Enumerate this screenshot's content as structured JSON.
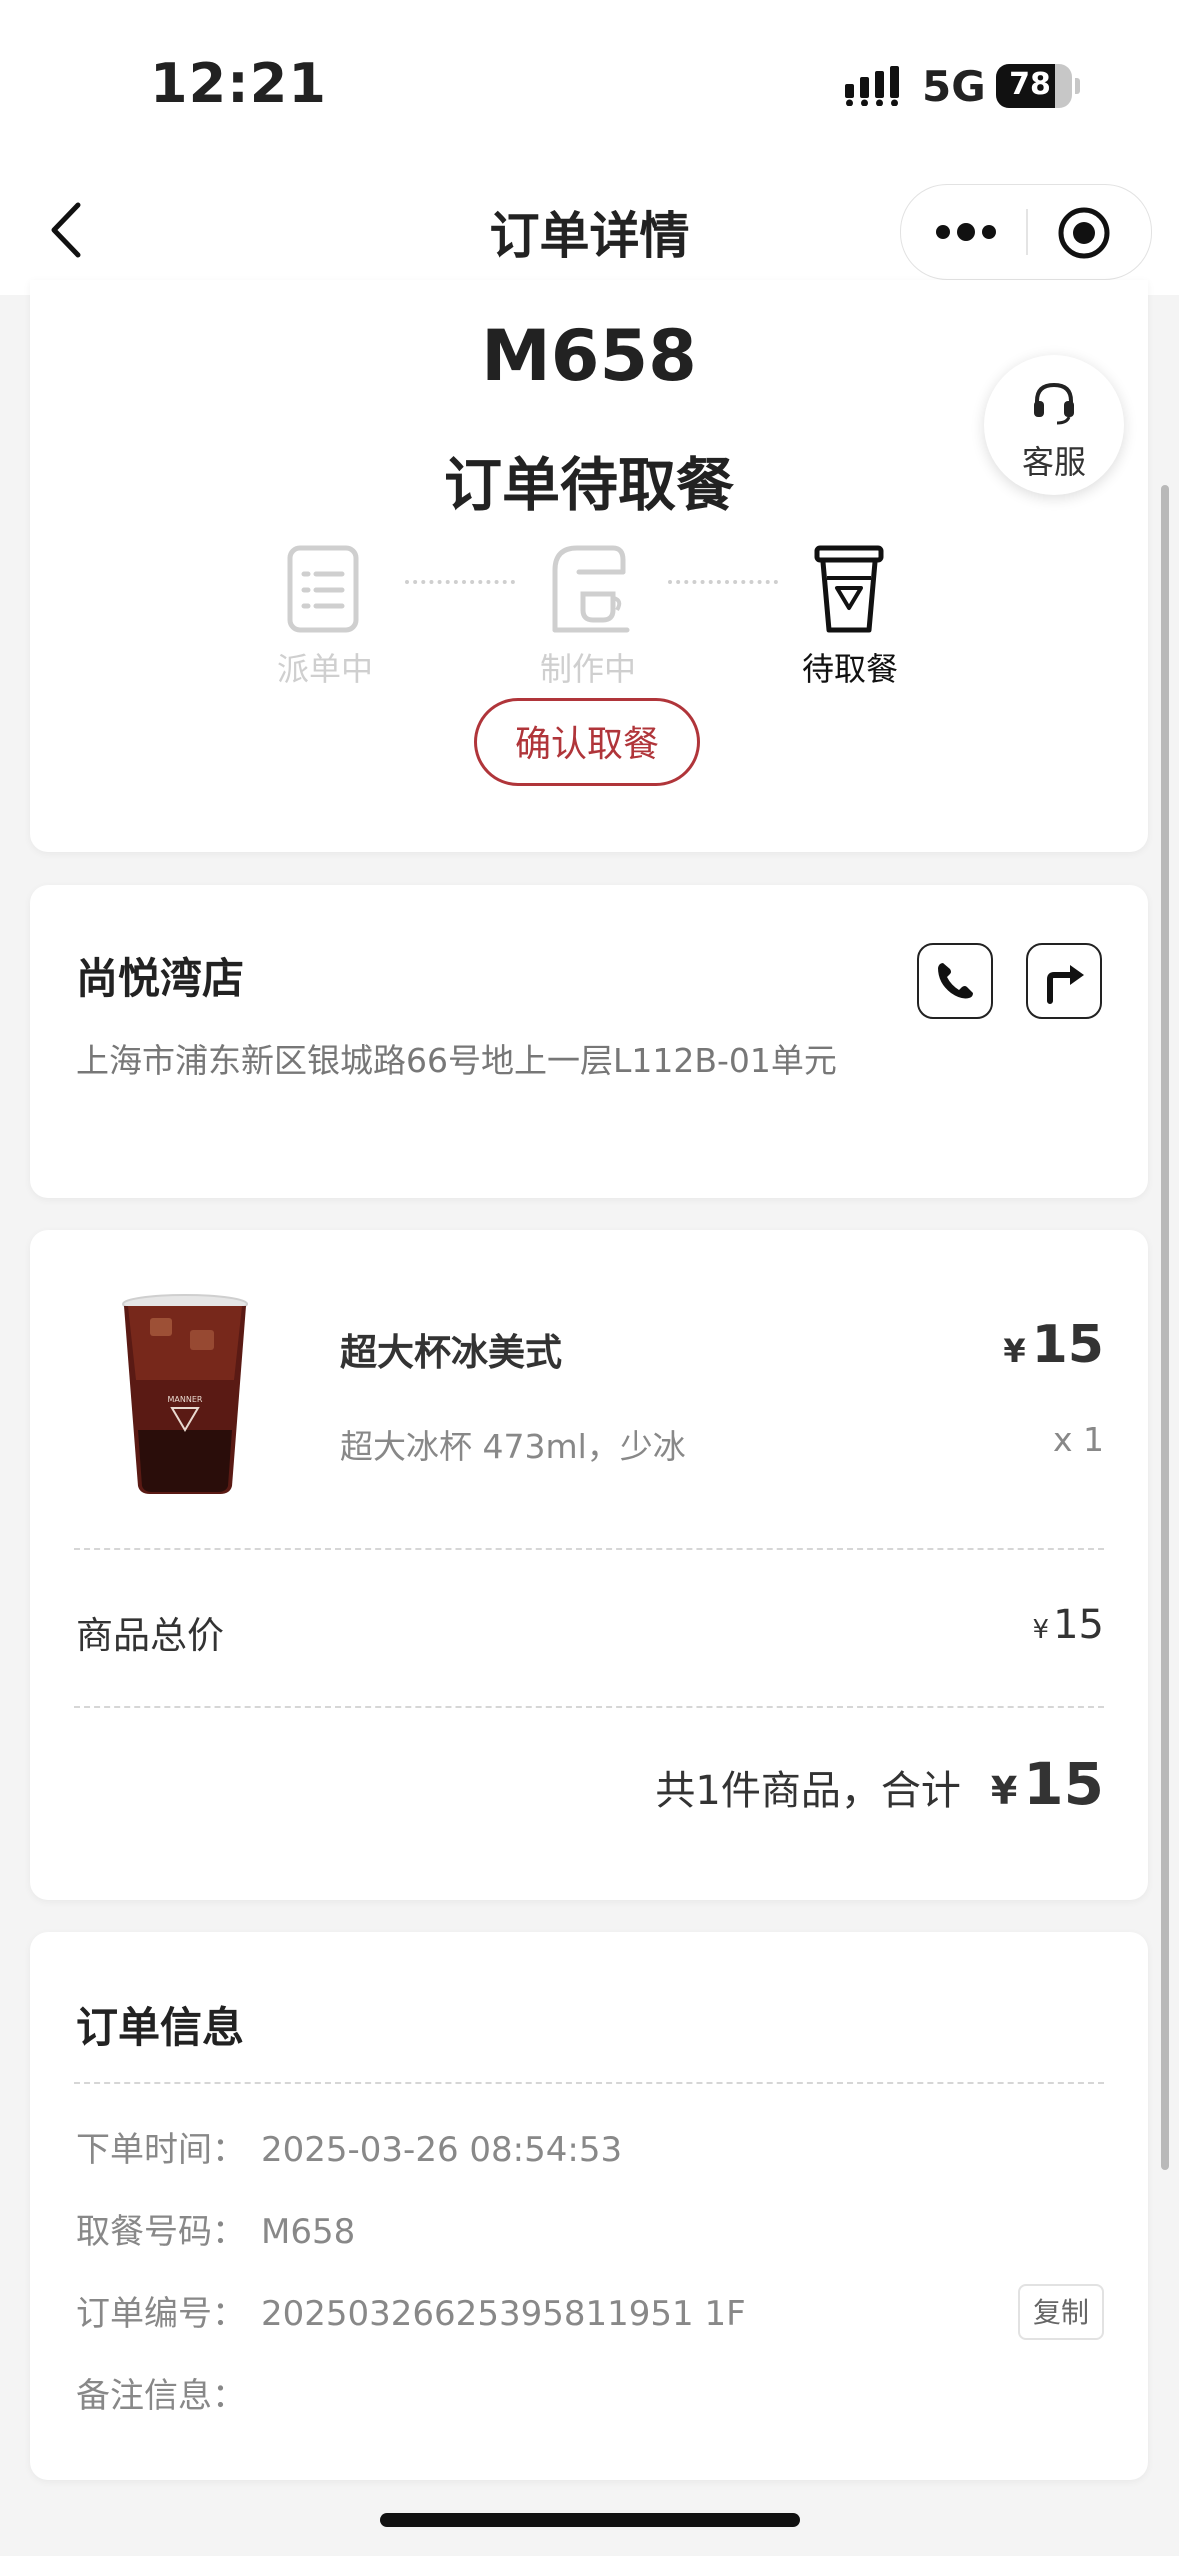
{
  "status_bar": {
    "time": "12:21",
    "network": "5G",
    "battery": "78",
    "battery_level": 0.78,
    "icons": [
      "signal-icon",
      "battery-icon"
    ]
  },
  "nav": {
    "title": "订单详情",
    "icons": [
      "back-chevron-icon",
      "more-dots-icon",
      "close-target-icon"
    ]
  },
  "order": {
    "code": "M658",
    "status": "订单待取餐",
    "steps": [
      {
        "label": "派单中",
        "icon": "order-list-icon",
        "active": false
      },
      {
        "label": "制作中",
        "icon": "coffee-machine-icon",
        "active": false
      },
      {
        "label": "待取餐",
        "icon": "pickup-cup-icon",
        "active": true
      }
    ],
    "confirm_label": "确认取餐"
  },
  "service": {
    "label": "客服",
    "icon": "headset-icon"
  },
  "store": {
    "name": "尚悦湾店",
    "address": "上海市浦东新区银城路66号地上一层L112B-01单元",
    "icons": [
      "phone-icon",
      "directions-icon"
    ]
  },
  "product": {
    "name": "超大杯冰美式",
    "currency": "¥",
    "price": "15",
    "spec": "超大冰杯 473ml，少冰",
    "qty": "x 1",
    "image_icon": "iced-americano-image"
  },
  "summary": {
    "subtotal_label": "商品总价",
    "subtotal": "15",
    "total_text": "共1件商品，合计",
    "total": "15"
  },
  "info": {
    "title": "订单信息",
    "rows": [
      {
        "label": "下单时间：",
        "value": "2025-03-26 08:54:53"
      },
      {
        "label": "取餐号码：",
        "value": "M658"
      },
      {
        "label": "订单编号：",
        "value": "20250326625395811951 1F"
      },
      {
        "label": "备注信息：",
        "value": ""
      }
    ],
    "copy_label": "复制"
  },
  "colors": {
    "accent_red": "#b0353a",
    "muted": "#cfcfcf",
    "text": "#222222",
    "gray_text": "#888888",
    "background": "#f4f4f4"
  }
}
